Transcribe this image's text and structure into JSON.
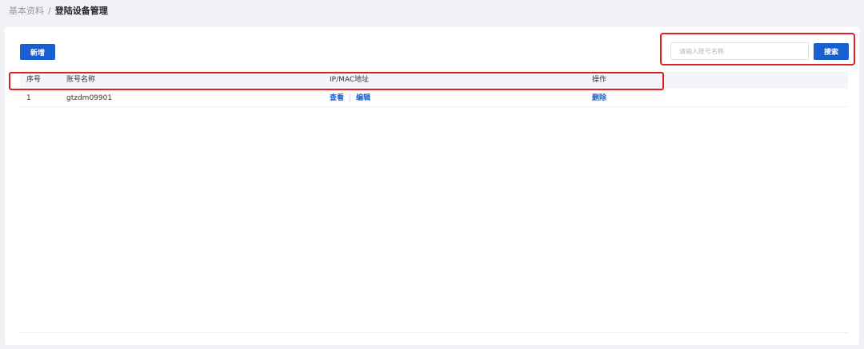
{
  "breadcrumb": {
    "parent": "基本资料",
    "separator": "/",
    "current": "登陆设备管理"
  },
  "toolbar": {
    "add_label": "新增"
  },
  "search": {
    "placeholder": "请输入账号名称",
    "value": "",
    "button_label": "搜索"
  },
  "table": {
    "columns": [
      "序号",
      "账号名称",
      "IP/MAC地址",
      "操作"
    ],
    "rows": [
      {
        "index": "1",
        "account": "gtzdm09901",
        "ip_actions": [
          "查看",
          "编辑"
        ],
        "operation": "删除"
      }
    ]
  },
  "colors": {
    "primary": "#1a5fd0",
    "highlight": "#e02020",
    "header_bg": "#f3f5f8",
    "page_bg": "#f0f2f5"
  }
}
